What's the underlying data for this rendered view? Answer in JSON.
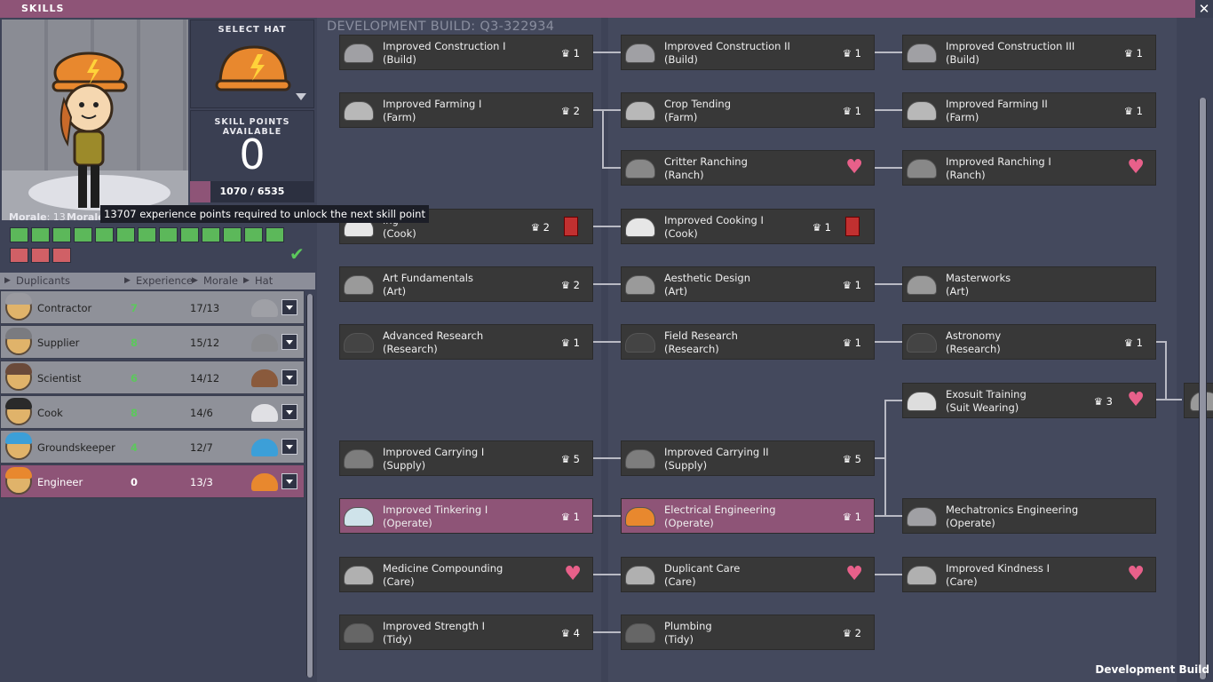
{
  "window": {
    "title": "SKILLS",
    "close_icon": "close-icon"
  },
  "hat_selector": {
    "label": "SELECT HAT",
    "icon": "hard-hat-icon",
    "color": "#e8882e"
  },
  "skill_points": {
    "label": "SKILL POINTS AVAILABLE",
    "value": "0",
    "xp_text": "1070 / 6535",
    "xp_progress": 0.164
  },
  "morale": {
    "label": "Morale",
    "value": "13",
    "label2": "Morale",
    "green_pips": 13,
    "red_pips": 3
  },
  "tooltip": "13707 experience points required to unlock the next skill point",
  "dupe_header": {
    "name": "Duplicants",
    "experience": "Experience",
    "morale": "Morale",
    "hat": "Hat"
  },
  "duplicants": [
    {
      "name": "Contractor",
      "experience": "7",
      "morale": "17/13",
      "hat_color": "#9fa0a6",
      "cap_color": "#9a9aa0",
      "selected": false
    },
    {
      "name": "Supplier",
      "experience": "8",
      "morale": "15/12",
      "hat_color": "#8a8b8f",
      "cap_color": "#7a7b80",
      "selected": false
    },
    {
      "name": "Scientist",
      "experience": "6",
      "morale": "14/12",
      "hat_color": "#8a5a3c",
      "cap_color": "#6a4a3a",
      "selected": false
    },
    {
      "name": "Cook",
      "experience": "8",
      "morale": "14/6",
      "hat_color": "#e0e0e4",
      "cap_color": "#2a2a2a",
      "selected": false
    },
    {
      "name": "Groundskeeper",
      "experience": "4",
      "morale": "12/7",
      "hat_color": "#3c9fd8",
      "cap_color": "#3c9fd8",
      "selected": false
    },
    {
      "name": "Engineer",
      "experience": "0",
      "morale": "13/3",
      "hat_color": "#e8882e",
      "cap_color": "#e8882e",
      "selected": true
    }
  ],
  "tree": {
    "dev_build": "DEVELOPMENT BUILD: Q3-322934",
    "footer": "Development Build",
    "skills": [
      {
        "id": "c1",
        "name": "Improved Construction I",
        "category": "(Build)",
        "cost": "1",
        "icon": "hard-hat-icon"
      },
      {
        "id": "c2",
        "name": "Improved Construction II",
        "category": "(Build)",
        "cost": "1",
        "icon": "hard-hat-icon"
      },
      {
        "id": "c3",
        "name": "Improved Construction III",
        "category": "(Build)",
        "cost": "1",
        "icon": "hard-hat-icon"
      },
      {
        "id": "f1",
        "name": "Improved Farming I",
        "category": "(Farm)",
        "cost": "2",
        "icon": "farm-hat-icon"
      },
      {
        "id": "f2",
        "name": "Crop Tending",
        "category": "(Farm)",
        "cost": "1",
        "icon": "farm-hat-icon"
      },
      {
        "id": "f3",
        "name": "Improved Farming II",
        "category": "(Farm)",
        "cost": "1",
        "icon": "farm-hat-icon"
      },
      {
        "id": "r1",
        "name": "Critter Ranching",
        "category": "(Ranch)",
        "cost": "",
        "icon": "ranch-hat-icon",
        "heart": true
      },
      {
        "id": "r2",
        "name": "Improved Ranching I",
        "category": "(Ranch)",
        "cost": "",
        "icon": "ranch-hat-icon",
        "heart": true
      },
      {
        "id": "k1",
        "name": "ing",
        "category": "(Cook)",
        "cost": "2",
        "icon": "chef-hat-icon",
        "dislike": true
      },
      {
        "id": "k2",
        "name": "Improved Cooking I",
        "category": "(Cook)",
        "cost": "1",
        "icon": "chef-hat-icon",
        "dislike": true
      },
      {
        "id": "a1",
        "name": "Art Fundamentals",
        "category": "(Art)",
        "cost": "2",
        "icon": "beret-icon"
      },
      {
        "id": "a2",
        "name": "Aesthetic Design",
        "category": "(Art)",
        "cost": "1",
        "icon": "beret-icon"
      },
      {
        "id": "a3",
        "name": "Masterworks",
        "category": "(Art)",
        "cost": "",
        "icon": "beret-icon"
      },
      {
        "id": "s1",
        "name": "Advanced Research",
        "category": "(Research)",
        "cost": "1",
        "icon": "research-hat-icon"
      },
      {
        "id": "s2",
        "name": "Field Research",
        "category": "(Research)",
        "cost": "1",
        "icon": "research-hat-icon"
      },
      {
        "id": "s3",
        "name": "Astronomy",
        "category": "(Research)",
        "cost": "1",
        "icon": "research-hat-icon"
      },
      {
        "id": "e1",
        "name": "Exosuit Training",
        "category": "(Suit Wearing)",
        "cost": "3",
        "icon": "suit-helmet-icon",
        "heart": true
      },
      {
        "id": "u1",
        "name": "Improved Carrying I",
        "category": "(Supply)",
        "cost": "5",
        "icon": "supply-cap-icon"
      },
      {
        "id": "u2",
        "name": "Improved Carrying II",
        "category": "(Supply)",
        "cost": "5",
        "icon": "supply-cap-icon"
      },
      {
        "id": "o1",
        "name": "Improved Tinkering I",
        "category": "(Operate)",
        "cost": "1",
        "icon": "hard-hat-icon",
        "selected": true
      },
      {
        "id": "o2",
        "name": "Electrical Engineering",
        "category": "(Operate)",
        "cost": "1",
        "icon": "hard-hat-icon",
        "selected": true
      },
      {
        "id": "o3",
        "name": "Mechatronics Engineering",
        "category": "(Operate)",
        "cost": "",
        "icon": "hard-hat-icon"
      },
      {
        "id": "m1",
        "name": "Medicine Compounding",
        "category": "(Care)",
        "cost": "",
        "icon": "nurse-cap-icon",
        "heart": true
      },
      {
        "id": "m2",
        "name": "Duplicant Care",
        "category": "(Care)",
        "cost": "",
        "icon": "nurse-cap-icon",
        "heart": true
      },
      {
        "id": "m3",
        "name": "Improved Kindness I",
        "category": "(Care)",
        "cost": "",
        "icon": "nurse-cap-icon",
        "heart": true
      },
      {
        "id": "t1",
        "name": "Improved Strength I",
        "category": "(Tidy)",
        "cost": "4",
        "icon": "tidy-cap-icon"
      },
      {
        "id": "t2",
        "name": "Plumbing",
        "category": "(Tidy)",
        "cost": "2",
        "icon": "tidy-cap-icon"
      }
    ]
  }
}
